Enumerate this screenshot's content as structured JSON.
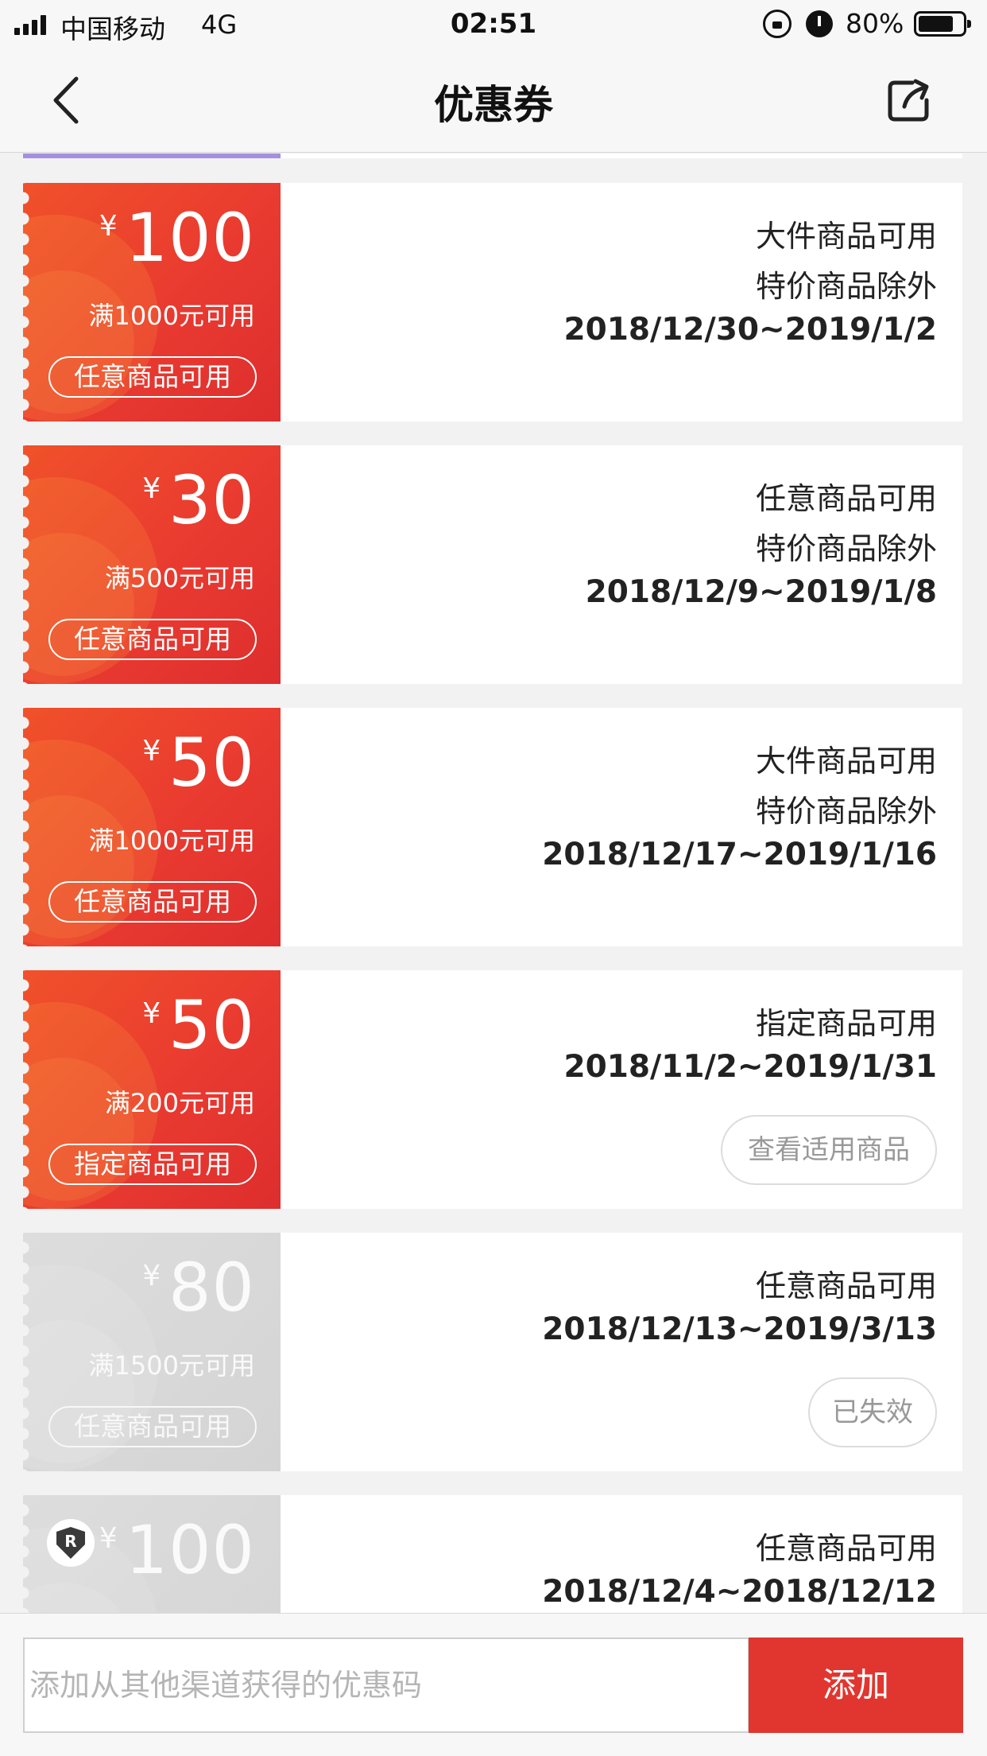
{
  "status_bar": {
    "carrier": "中国移动",
    "network": "4G",
    "time": "02:51",
    "battery_percent": "80%",
    "battery_level": 0.8,
    "icons": [
      "signal-icon",
      "orientation-lock-icon",
      "alarm-icon",
      "battery-icon"
    ]
  },
  "nav": {
    "title": "优惠券",
    "back_icon": "chevron-left-icon",
    "share_icon": "share-icon"
  },
  "coupons": [
    {
      "currency": "¥",
      "amount": "100",
      "condition": "满1000元可用",
      "scope": "任意商品可用",
      "lines": [
        "大件商品可用",
        "特价商品除外"
      ],
      "date": "2018/12/30~2019/1/2",
      "expired": false
    },
    {
      "currency": "¥",
      "amount": "30",
      "condition": "满500元可用",
      "scope": "任意商品可用",
      "lines": [
        "任意商品可用",
        "特价商品除外"
      ],
      "date": "2018/12/9~2019/1/8",
      "expired": false
    },
    {
      "currency": "¥",
      "amount": "50",
      "condition": "满1000元可用",
      "scope": "任意商品可用",
      "lines": [
        "大件商品可用",
        "特价商品除外"
      ],
      "date": "2018/12/17~2019/1/16",
      "expired": false
    },
    {
      "currency": "¥",
      "amount": "50",
      "condition": "满200元可用",
      "scope": "指定商品可用",
      "lines": [
        "指定商品可用"
      ],
      "date": "2018/11/2~2019/1/31",
      "action": "查看适用商品",
      "expired": false
    },
    {
      "currency": "¥",
      "amount": "80",
      "condition": "满1500元可用",
      "scope": "任意商品可用",
      "lines": [
        "任意商品可用"
      ],
      "date": "2018/12/13~2019/3/13",
      "action": "已失效",
      "expired": true
    },
    {
      "currency": "¥",
      "amount": "100",
      "lines": [
        "任意商品可用"
      ],
      "date": "2018/12/4~2018/12/12",
      "badge_icon": "shield-icon",
      "badge_letter": "R",
      "expired": true
    }
  ],
  "add_code": {
    "placeholder": "添加从其他渠道获得的优惠码",
    "button_label": "添加"
  },
  "colors": {
    "coupon_red": "#e93a30",
    "coupon_gray": "#d8d8d8",
    "add_button": "#e1362f"
  }
}
